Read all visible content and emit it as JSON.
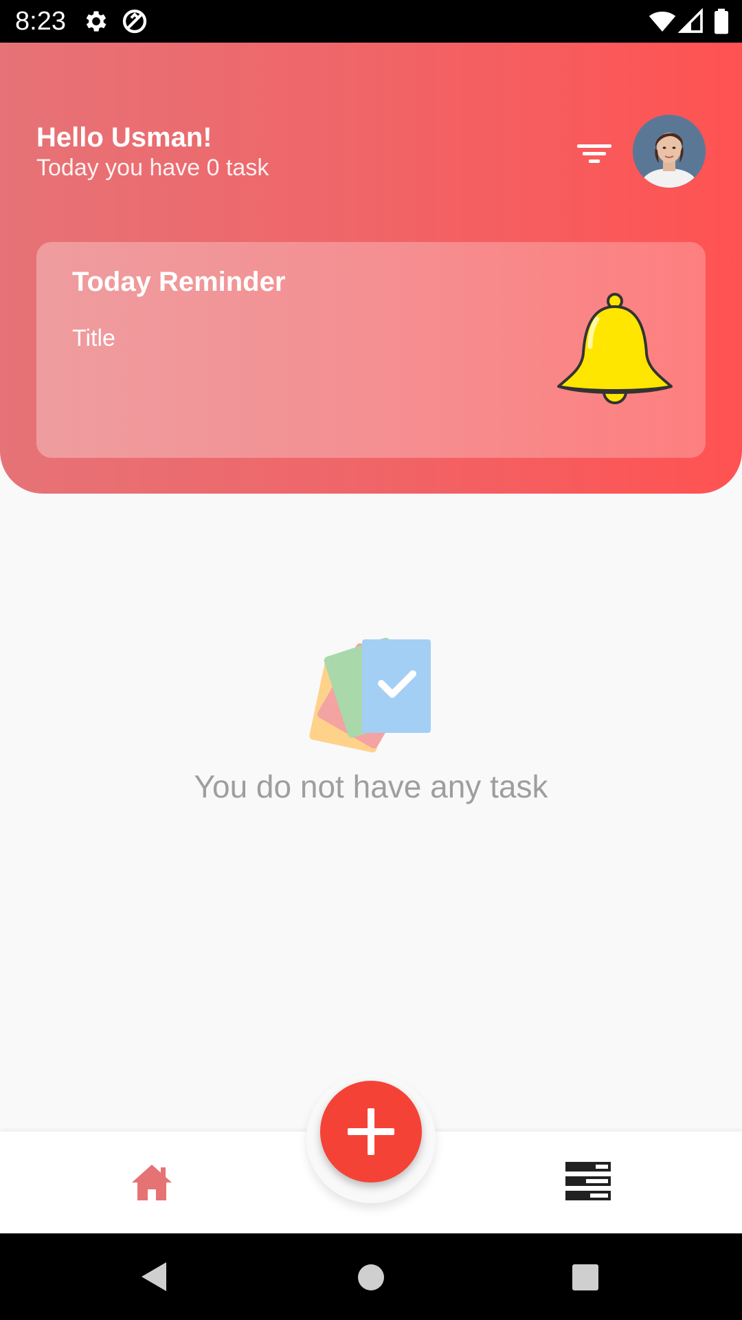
{
  "status_bar": {
    "time": "8:23",
    "icons": [
      "gear-icon",
      "sync-icon",
      "wifi-icon",
      "signal-icon",
      "battery-icon"
    ]
  },
  "header": {
    "greeting": "Hello Usman!",
    "subtitle": "Today you have 0 task",
    "filter_icon": "filter-icon",
    "avatar": "user-avatar"
  },
  "reminder": {
    "title": "Today Reminder",
    "subtitle": "Title",
    "icon": "bell-icon"
  },
  "empty_state": {
    "icon": "task-cards-icon",
    "message": "You do not have any task"
  },
  "bottom_nav": {
    "items": [
      {
        "icon": "home-icon",
        "active": true
      },
      {
        "icon": "list-icon",
        "active": false
      }
    ],
    "fab_icon": "plus-icon"
  },
  "system_nav": [
    "back-icon",
    "home-circle-icon",
    "recents-icon"
  ],
  "colors": {
    "accent": "#f44336",
    "header_start": "#e67377",
    "header_end": "#ff5252",
    "bell": "#ffe600",
    "home_active": "#e57373"
  }
}
